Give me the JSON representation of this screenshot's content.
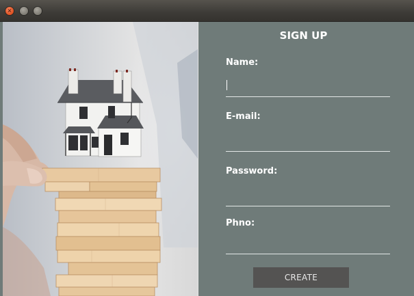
{
  "window": {
    "controls": [
      {
        "name": "close-icon",
        "symbol": "×"
      },
      {
        "name": "minimize-icon",
        "symbol": ""
      },
      {
        "name": "maximize-icon",
        "symbol": ""
      }
    ]
  },
  "illustration": {
    "description_icon": "house-on-wooden-blocks-photo"
  },
  "form": {
    "title": "SIGN UP",
    "fields": [
      {
        "label": "Name:",
        "value": "",
        "focused": true
      },
      {
        "label": "E-mail:",
        "value": ""
      },
      {
        "label": "Password:",
        "value": ""
      },
      {
        "label": "Phno:",
        "value": ""
      }
    ],
    "submit_label": "CREATE"
  },
  "colors": {
    "form_background": "#6f7b79",
    "button_background": "#545352",
    "close_button": "#e0501f"
  }
}
